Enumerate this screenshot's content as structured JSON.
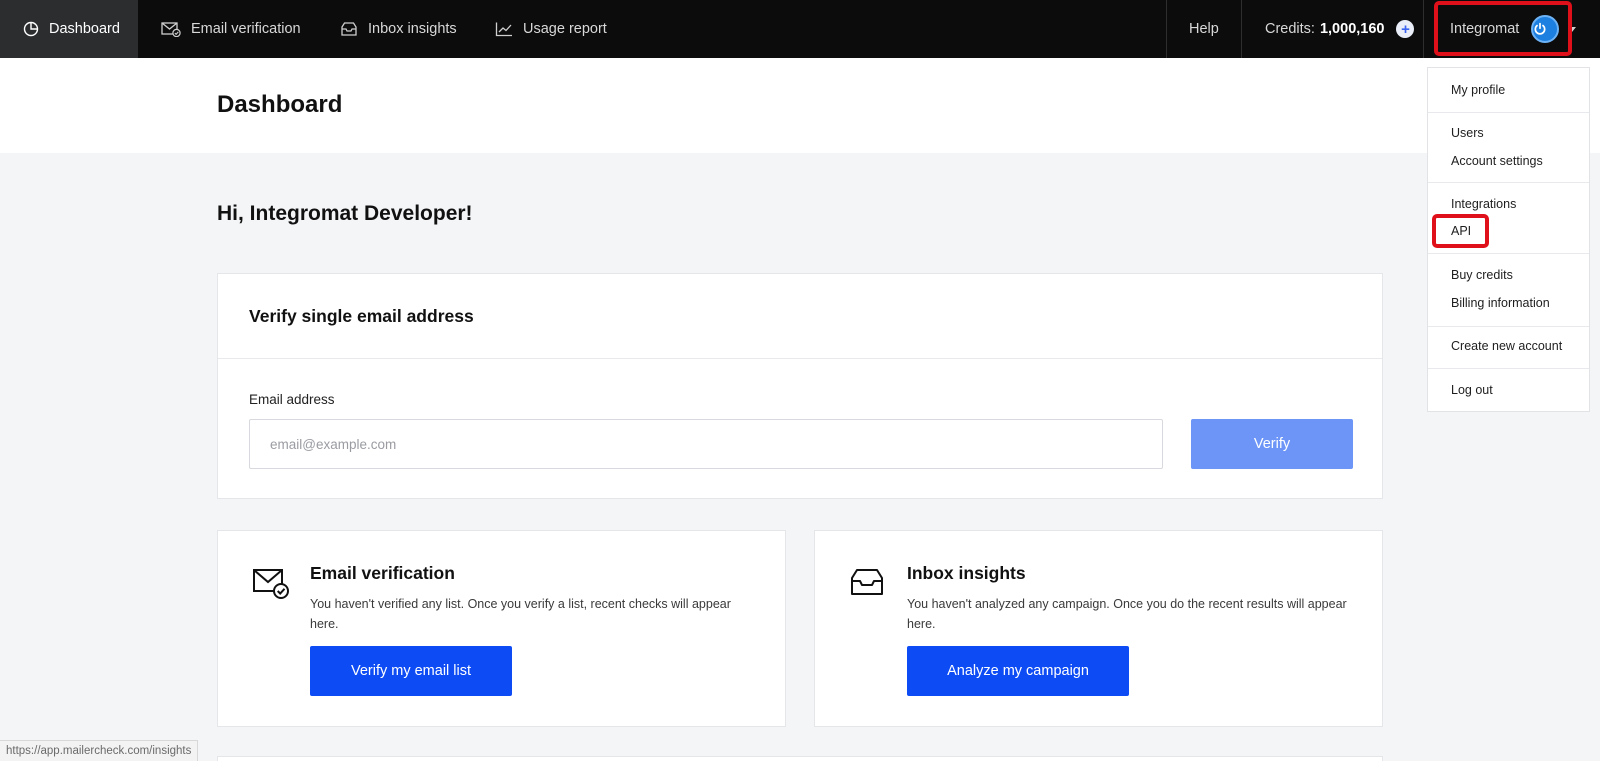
{
  "nav": {
    "items": [
      {
        "label": "Dashboard",
        "icon": "chart-pie-icon"
      },
      {
        "label": "Email verification",
        "icon": "mail-check-icon"
      },
      {
        "label": "Inbox insights",
        "icon": "inbox-icon"
      },
      {
        "label": "Usage report",
        "icon": "line-chart-icon"
      }
    ],
    "help": "Help",
    "credits_label": "Credits:",
    "credits_value": "1,000,160",
    "account_name": "Integromat",
    "add_symbol": "+"
  },
  "header": {
    "title": "Dashboard"
  },
  "greeting": "Hi, Integromat Developer!",
  "verify_card": {
    "title": "Verify single email address",
    "email_label": "Email address",
    "email_placeholder": "email@example.com",
    "button": "Verify"
  },
  "email_verification_card": {
    "title": "Email verification",
    "description": "You haven't verified any list. Once you verify a list, recent checks will appear here.",
    "button": "Verify my email list"
  },
  "inbox_insights_card": {
    "title": "Inbox insights",
    "description": "You haven't analyzed any campaign. Once you do the recent results will appear here.",
    "button": "Analyze my campaign"
  },
  "dropdown": {
    "my_profile": "My profile",
    "users": "Users",
    "account_settings": "Account settings",
    "integrations": "Integrations",
    "api": "API",
    "buy_credits": "Buy credits",
    "billing_information": "Billing information",
    "create_new_account": "Create new account",
    "log_out": "Log out"
  },
  "status_url": "https://app.mailercheck.com/insights",
  "colors": {
    "nav_bg": "#0c0c0c",
    "nav_active_bg": "#2b2d2f",
    "primary_button": "#0d4cf5",
    "verify_button": "#6c95f7",
    "highlight": "#e0101a",
    "avatar": "#1d7fe0"
  }
}
